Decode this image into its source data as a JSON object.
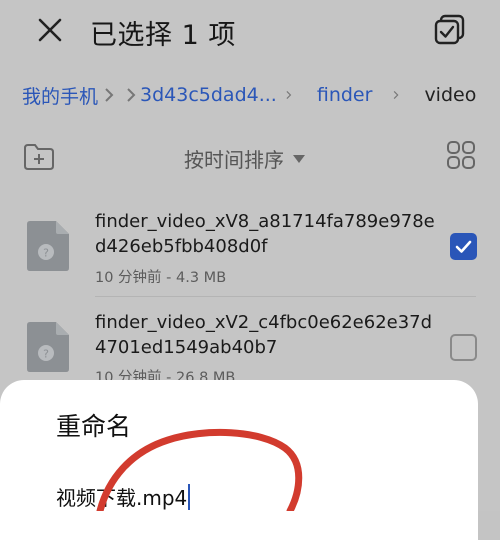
{
  "header": {
    "title": "已选择 1 项"
  },
  "breadcrumb": {
    "items": [
      "我的手机",
      "3d43c5dad4...",
      "finder"
    ],
    "current": "video"
  },
  "toolbar": {
    "sort_label": "按时间排序"
  },
  "files": [
    {
      "name": "finder_video_xV8_a81714fa789e978ed426eb5fbb408d0f",
      "meta": "10 分钟前 - 4.3 MB",
      "checked": true
    },
    {
      "name": "finder_video_xV2_c4fbc0e62e62e37d4701ed1549ab40b7",
      "meta": "10 分钟前 - 26.8 MB",
      "checked": false
    }
  ],
  "dialog": {
    "title": "重命名",
    "input_value": "视频下载.mp4"
  },
  "colors": {
    "accent": "#2a56b8",
    "dim_background": "#c5c5c5",
    "annotation": "#d23b2e"
  }
}
